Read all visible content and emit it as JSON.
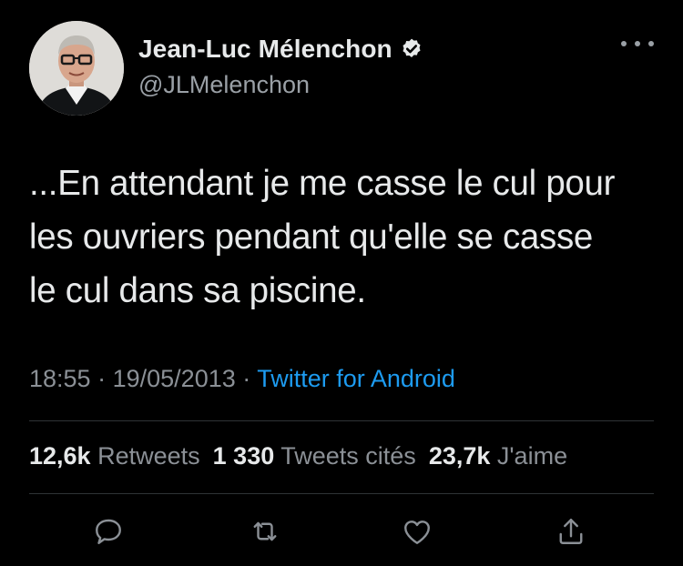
{
  "author": {
    "name": "Jean-Luc Mélenchon",
    "handle": "@JLMelenchon",
    "verified": true
  },
  "tweet": {
    "text_lines": [
      "...En attendant je me casse le cul pour",
      "les ouvriers pendant qu'elle se casse",
      "le cul dans sa piscine."
    ]
  },
  "meta": {
    "time": "18:55",
    "separator": "·",
    "date": "19/05/2013",
    "source": "Twitter for Android"
  },
  "stats": {
    "retweets_count": "12,6k",
    "retweets_label": "Retweets",
    "quotes_count": "1 330",
    "quotes_label": "Tweets cités",
    "likes_count": "23,7k",
    "likes_label": "J'aime"
  },
  "icons": {
    "more": "more-horizontal-icon",
    "verified": "verified-badge-icon",
    "reply": "reply-icon",
    "retweet": "retweet-icon",
    "like": "heart-icon",
    "share": "share-icon"
  },
  "colors": {
    "background": "#000000",
    "text": "#e7e9ea",
    "muted": "#8b9096",
    "link": "#1d9bf0",
    "divider": "#2f3336"
  }
}
